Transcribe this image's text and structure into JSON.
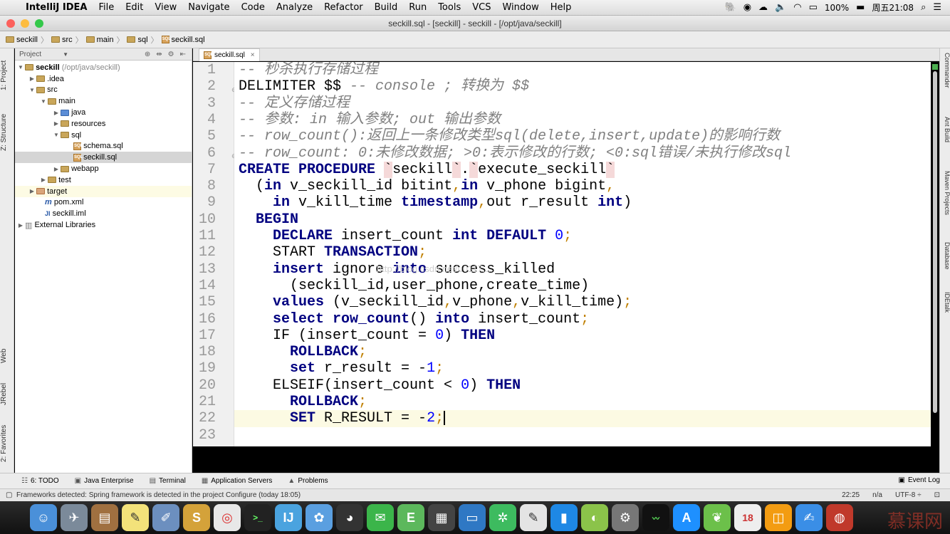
{
  "menubar": {
    "app_name": "IntelliJ IDEA",
    "items": [
      "File",
      "Edit",
      "View",
      "Navigate",
      "Code",
      "Analyze",
      "Refactor",
      "Build",
      "Run",
      "Tools",
      "VCS",
      "Window",
      "Help"
    ],
    "battery": "100%",
    "clock": "周五21:08"
  },
  "window": {
    "title": "seckill.sql - [seckill] - seckill - [/opt/java/seckill]"
  },
  "breadcrumbs": [
    "seckill",
    "src",
    "main",
    "sql",
    "seckill.sql"
  ],
  "left_tabs": [
    "1: Project",
    "Z: Structure",
    "Web",
    "JRebel",
    "2: Favorites"
  ],
  "project": {
    "header": "Project",
    "root_name": "seckill",
    "root_path": "(/opt/java/seckill)",
    "items": {
      "idea": ".idea",
      "src": "src",
      "main": "main",
      "java": "java",
      "resources": "resources",
      "sql": "sql",
      "schema": "schema.sql",
      "seckill_sql": "seckill.sql",
      "webapp": "webapp",
      "test": "test",
      "target": "target",
      "pom": "pom.xml",
      "iml": "seckill.iml",
      "libs": "External Libraries"
    }
  },
  "editor": {
    "tab": "seckill.sql",
    "line_numbers": [
      "1",
      "2",
      "3",
      "4",
      "5",
      "6",
      "7",
      "8",
      "9",
      "10",
      "11",
      "12",
      "13",
      "14",
      "15",
      "16",
      "17",
      "18",
      "19",
      "20",
      "21",
      "22",
      "23"
    ],
    "code": {
      "l1": "-- 秒杀执行存储过程",
      "l2a": "DELIMITER $$ ",
      "l2b": "-- console ; 转换为 $$",
      "l3": "-- 定义存储过程",
      "l4": "-- 参数: in 输入参数; out 输出参数",
      "l5": "-- row_count():返回上一条修改类型sql(delete,insert,update)的影响行数",
      "l6": "-- row_count: 0:未修改数据; >0:表示修改的行数; <0:sql错误/未执行修改sql",
      "create": "CREATE PROCEDURE",
      "bt": "`",
      "db": "seckill",
      "dot": ".",
      "proc": "execute_seckill",
      "in": "in",
      "out": "out",
      "l8_open": "(",
      "l8_p1": " v_seckill_id bitint",
      "comma": ",",
      "l8_p2": " v_phone bigint",
      "l9_p1": " v_kill_time ",
      "timestamp": "timestamp",
      "l9_p2": "out",
      "l9_p3": " r_result ",
      "int": "int",
      "close": ")",
      "begin": "BEGIN",
      "declare": "DECLARE",
      "l11_var": " insert_count ",
      "default": "DEFAULT",
      "zero": "0",
      "semi": ";",
      "start": "START ",
      "transaction": "TRANSACTION",
      "insert": "insert",
      "ignore": " ignore ",
      "into": "into",
      "l13_tbl": " success_killed",
      "l14": "(seckill_id,user_phone,create_time)",
      "values": "values",
      "l15_open": " (v_seckill_id",
      "l15_p2": "v_phone",
      "l15_p3": "v_kill_time)",
      "select": "select",
      "row_count": "row_count",
      "parens": "()",
      "l16_var": " insert_count",
      "if": "IF (insert_count = ",
      "then": "THEN",
      "rollback": "ROLLBACK",
      "set_lower": "set",
      "l19_var": " r_result = -",
      "one": "1",
      "elseif": "ELSEIF(insert_count < ",
      "set_upper": "SET",
      "l22_var": " R_RESULT = -",
      "two": "2",
      "zero_close": ") "
    },
    "watermark": "http://blog.csdn.net/u0117..."
  },
  "right_tabs": [
    "Commander",
    "Ant Build",
    "Maven Projects",
    "Database",
    "IDEtalk"
  ],
  "bottom_tools": [
    "6: TODO",
    "Java Enterprise",
    "Terminal",
    "Application Servers",
    "Problems"
  ],
  "event_log": "Event Log",
  "status": {
    "message": "Frameworks detected: Spring framework is detected in the project Configure (today 18:05)",
    "position": "22:25",
    "line_sep": "n/a",
    "encoding": "UTF-8 ÷"
  },
  "dock_watermark": "慕课网",
  "colors": {
    "keyword": "#000080",
    "comment": "#808080",
    "number": "#0000ff",
    "line_number": "#999999"
  }
}
